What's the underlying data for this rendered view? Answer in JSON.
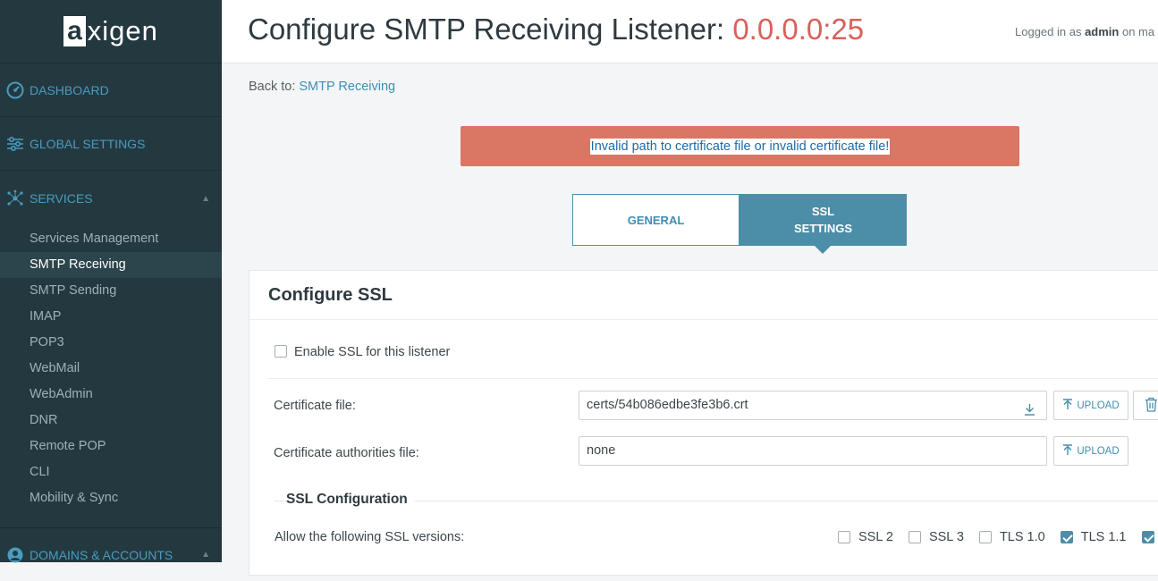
{
  "app": {
    "logo_box": "a",
    "logo_text": "xigen"
  },
  "sidebar": {
    "sections": [
      {
        "label": "DASHBOARD",
        "icon": "dashboard-icon"
      },
      {
        "label": "GLOBAL SETTINGS",
        "icon": "sliders-icon"
      },
      {
        "label": "SERVICES",
        "icon": "network-icon",
        "expanded": true
      },
      {
        "label": "DOMAINS & ACCOUNTS",
        "icon": "globe-icon"
      }
    ],
    "services_items": [
      "Services Management",
      "SMTP Receiving",
      "SMTP Sending",
      "IMAP",
      "POP3",
      "WebMail",
      "WebAdmin",
      "DNR",
      "Remote POP",
      "CLI",
      "Mobility & Sync"
    ],
    "active_item": "SMTP Receiving"
  },
  "header": {
    "title": "Configure SMTP Receiving Listener: ",
    "title_accent": "0.0.0.0:25",
    "logged_prefix": "Logged in as ",
    "logged_user": "admin",
    "logged_suffix": " on ma"
  },
  "breadcrumb": {
    "prefix": "Back to:",
    "link": "SMTP Receiving"
  },
  "error_message": "Invalid path to certificate file or invalid certificate file!",
  "tabs": {
    "general": "GENERAL",
    "ssl_line1": "SSL",
    "ssl_line2": "SETTINGS",
    "active": "SSL SETTINGS"
  },
  "panel": {
    "title": "Configure SSL",
    "enable_label": "Enable SSL for this listener",
    "enable_checked": false,
    "cert_label": "Certificate file:",
    "cert_value": "certs/54b086edbe3fe3b6.crt",
    "ca_label": "Certificate authorities file:",
    "ca_value": "none",
    "upload_label": "UPLOAD",
    "ssl_config_title": "SSL Configuration",
    "versions_label": "Allow the following SSL versions:",
    "versions": [
      {
        "label": "SSL 2",
        "checked": false
      },
      {
        "label": "SSL 3",
        "checked": false
      },
      {
        "label": "TLS 1.0",
        "checked": false
      },
      {
        "label": "TLS 1.1",
        "checked": true
      },
      {
        "label": "",
        "checked": true
      }
    ]
  },
  "colors": {
    "sidebar_bg": "#23393f",
    "accent": "#4c8da7",
    "error_bg": "#d97664",
    "title_accent": "#d9605a"
  }
}
